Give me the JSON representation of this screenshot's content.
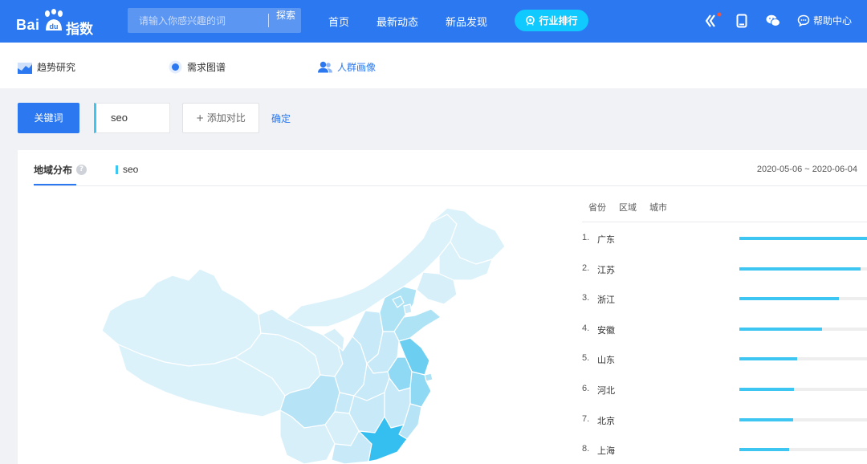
{
  "header": {
    "logo_text": "Bai",
    "logo_paw_text": "du",
    "logo_suffix": "指数",
    "search_placeholder": "请输入你感兴趣的词",
    "search_button": "探索",
    "nav": [
      "首页",
      "最新动态",
      "新品发现"
    ],
    "rank_pill": "行业排行",
    "help": "帮助中心"
  },
  "subnav": {
    "items": [
      {
        "label": "趋势研究"
      },
      {
        "label": "需求图谱"
      },
      {
        "label": "人群画像"
      }
    ]
  },
  "keyword_bar": {
    "label": "关键词",
    "keyword": "seo",
    "add_compare": "+ 添加对比",
    "confirm": "确定"
  },
  "panel": {
    "tab_title": "地域分布",
    "legend": "seo",
    "date_range": "2020-05-06 ~ 2020-06-04",
    "rank_tabs": [
      "省份",
      "区域",
      "城市"
    ],
    "ranking": [
      {
        "rank": "1.",
        "name": "广东",
        "value": 1.0
      },
      {
        "rank": "2.",
        "name": "江苏",
        "value": 0.95
      },
      {
        "rank": "3.",
        "name": "浙江",
        "value": 0.78
      },
      {
        "rank": "4.",
        "name": "安徽",
        "value": 0.65
      },
      {
        "rank": "5.",
        "name": "山东",
        "value": 0.45
      },
      {
        "rank": "6.",
        "name": "河北",
        "value": 0.43
      },
      {
        "rank": "7.",
        "name": "北京",
        "value": 0.42
      },
      {
        "rank": "8.",
        "name": "上海",
        "value": 0.39
      }
    ]
  },
  "colors": {
    "primary": "#2b78f0",
    "accent": "#3ec6f2",
    "pill": "#0fc9ff"
  }
}
